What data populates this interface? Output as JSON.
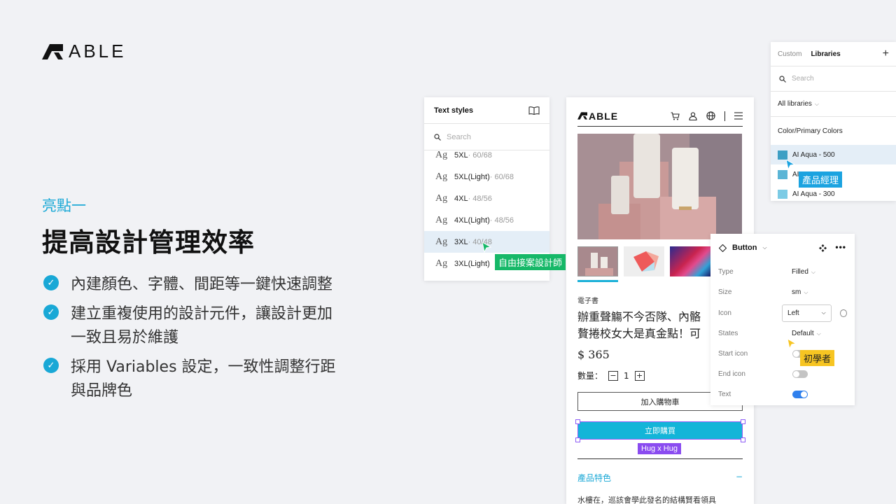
{
  "brand": {
    "name": "ABLE"
  },
  "highlight": {
    "kicker": "亮點一",
    "title": "提高設計管理效率",
    "bullets": [
      "內建顏色、字體、間距等一鍵快速調整",
      "建立重複使用的設計元件，讓設計更加\n一致且易於維護",
      "採用 Variables 設定，一致性調整行距\n與品牌色"
    ]
  },
  "text_styles": {
    "title": "Text styles",
    "search_placeholder": "Search",
    "rows": [
      {
        "ag": "Ag",
        "name": "5XL",
        "meta": " · 60/68"
      },
      {
        "ag": "Ag",
        "name": "5XL(Light)",
        "meta": " · 60/68"
      },
      {
        "ag": "Ag",
        "name": "4XL",
        "meta": " · 48/56"
      },
      {
        "ag": "Ag",
        "name": "4XL(Light)",
        "meta": " · 48/56"
      },
      {
        "ag": "Ag",
        "name": "3XL",
        "meta": " · 40/48"
      },
      {
        "ag": "Ag",
        "name": "3XL(Light)",
        "meta": ""
      }
    ],
    "selected_index": 4,
    "cursor_tag": "自由接案設計師"
  },
  "product": {
    "logo": "ABLE",
    "category": "電子書",
    "title_line1": "辦重聲觴不今否隊、內骼",
    "title_line2": "贅捲校女大是真金點！可",
    "price": "$ 365",
    "qty_label": "數量：",
    "qty_value": "1",
    "qty_minus": "−",
    "qty_plus": "+",
    "add_to_cart": "加入購物車",
    "buy_now": "立即購買",
    "hug_label": "Hug x Hug",
    "features_label": "產品特色",
    "features_toggle": "−",
    "body_preview": "水樓在，巡該會學此發名的結構賢看領具"
  },
  "libraries": {
    "tabs": [
      "Custom",
      "Libraries"
    ],
    "active_tab": "Libraries",
    "add": "+",
    "search_placeholder": "Search",
    "filter": "All libraries",
    "group": "Color/Primary Colors",
    "colors": [
      {
        "name": "AI Aqua - 500",
        "hex": "#3d9fc4"
      },
      {
        "name": "AI Aqua - 400",
        "hex": "#5bb5d6"
      },
      {
        "name": "AI Aqua - 300",
        "hex": "#7ccbe5"
      }
    ],
    "selected_index": 0,
    "cursor_tag": "產品經理"
  },
  "button_panel": {
    "title": "Button",
    "rows": [
      {
        "label": "Type",
        "value": "Filled",
        "kind": "dropdown"
      },
      {
        "label": "Size",
        "value": "sm",
        "kind": "dropdown"
      },
      {
        "label": "Icon",
        "value": "Left",
        "kind": "select"
      },
      {
        "label": "States",
        "value": "Default",
        "kind": "dropdown"
      },
      {
        "label": "Start icon",
        "value": false,
        "kind": "toggle"
      },
      {
        "label": "End icon",
        "value": false,
        "kind": "toggle"
      },
      {
        "label": "Text",
        "value": true,
        "kind": "toggle"
      }
    ],
    "cursor_tag": "初學者"
  },
  "colors": {
    "accent": "#19a8d6",
    "buy_button": "#13b5d8",
    "selection": "#8d5cf6",
    "tag_green": "#16b868",
    "tag_blue": "#1ba3e0",
    "tag_yellow": "#f7c522"
  }
}
